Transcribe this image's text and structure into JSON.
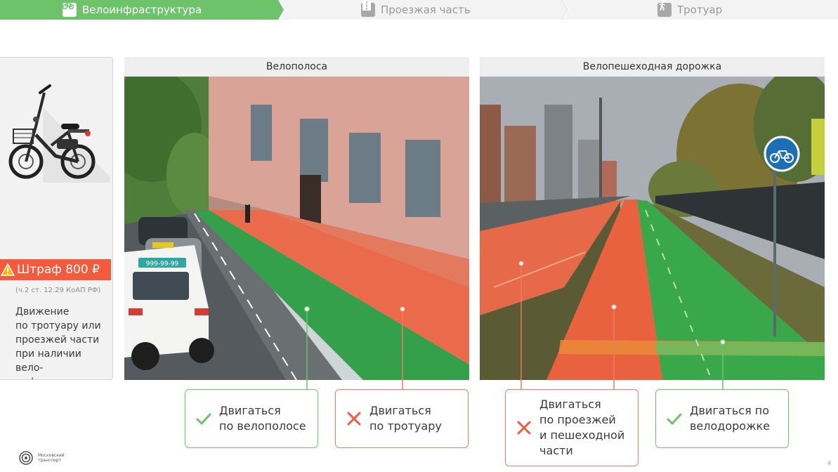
{
  "stepper": {
    "steps": [
      {
        "label": "Велоинфраструктура",
        "icon": "bicycle-icon",
        "active": true
      },
      {
        "label": "Проезжая часть",
        "icon": "road-icon",
        "active": false
      },
      {
        "label": "Тротуар",
        "icon": "pedestrian-icon",
        "active": false
      }
    ]
  },
  "info": {
    "fine": "Штраф 800 ₽",
    "reference": "(ч.2 ст. 12.29 КоАП РФ)",
    "description": "Движение\nпо тротуару или\nпроезжей части\nпри наличии\nвело-\nинфраструктуры",
    "icon": "warning-icon"
  },
  "photos": {
    "left_title": "Велополоса",
    "right_title": "Велопешеходная дорожка",
    "taxi_plate": "999-99-99"
  },
  "results": [
    {
      "type": "ok",
      "text": "Двигаться\nпо велополосе"
    },
    {
      "type": "no",
      "text": "Двигаться\nпо тротуару"
    },
    {
      "type": "no",
      "text": "Двигаться\nпо проезжей\nи пешеходной\nчасти"
    },
    {
      "type": "ok",
      "text": "Двигаться по\nвелодорожке"
    }
  ],
  "footer": {
    "logo_text": "Московский\nтранспорт",
    "page_number": "4"
  },
  "colors": {
    "accent_green": "#6cc36a",
    "accent_red": "#f45a3d",
    "ok_border": "#6cc36a",
    "no_border": "#f07a62"
  }
}
